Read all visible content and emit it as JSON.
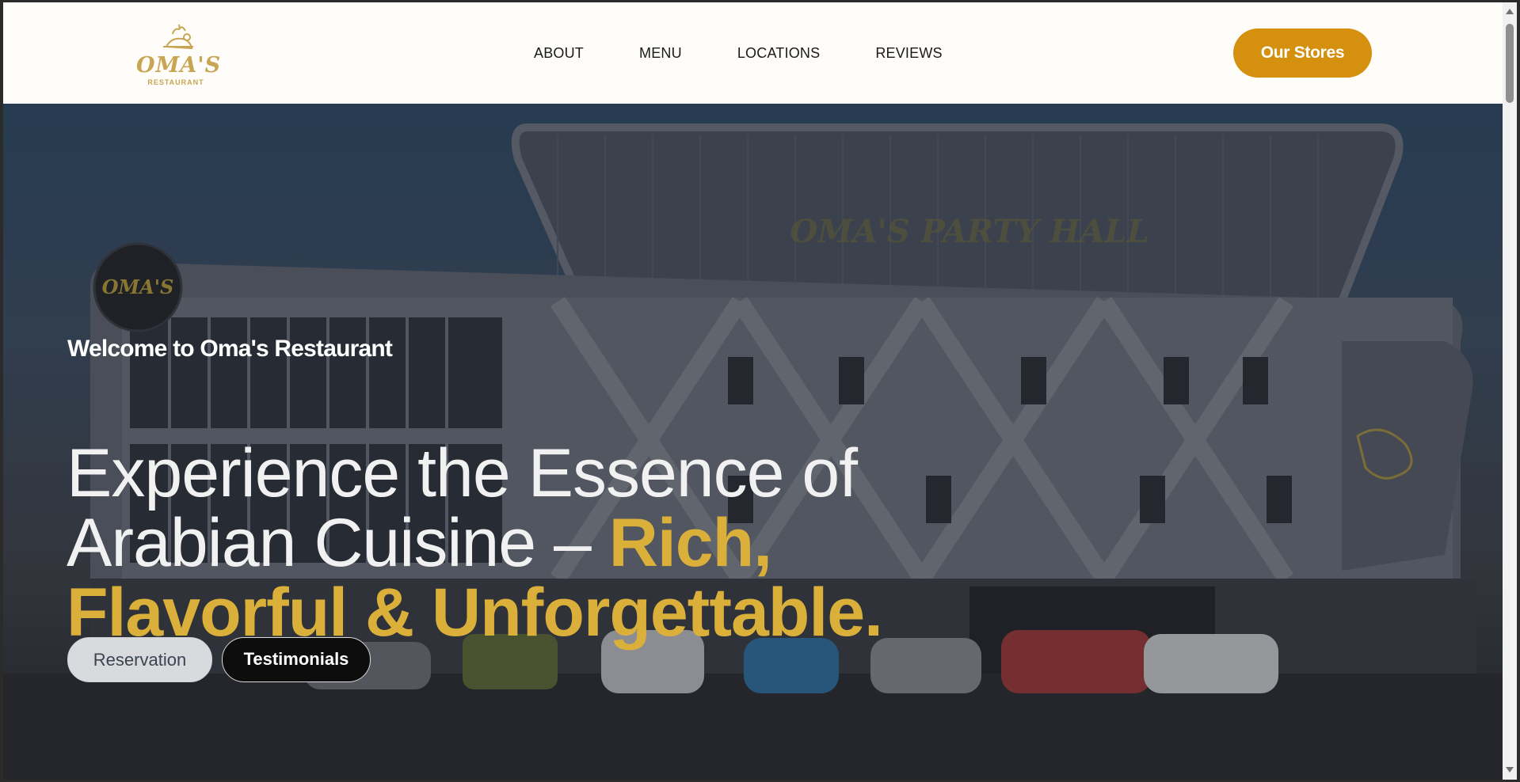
{
  "header": {
    "logo_text": "OMA'S",
    "logo_sub": "RESTAURANT",
    "nav": [
      "ABOUT",
      "MENU",
      "LOCATIONS",
      "REVIEWS"
    ],
    "stores_label": "Our Stores"
  },
  "hero": {
    "welcome": "Welcome to Oma's Restaurant",
    "headline_plain": "Experience the Essence of Arabian Cuisine – ",
    "headline_accent": "Rich, Flavorful & Unforgettable.",
    "building_sign": "OMA'S PARTY HALL",
    "badge_text": "OMA'S",
    "reservation_label": "Reservation",
    "testimonials_label": "Testimonials"
  },
  "colors": {
    "accent": "#d4900e",
    "headline_accent": "#dbb03a",
    "logo_gold": "#c8a552"
  }
}
